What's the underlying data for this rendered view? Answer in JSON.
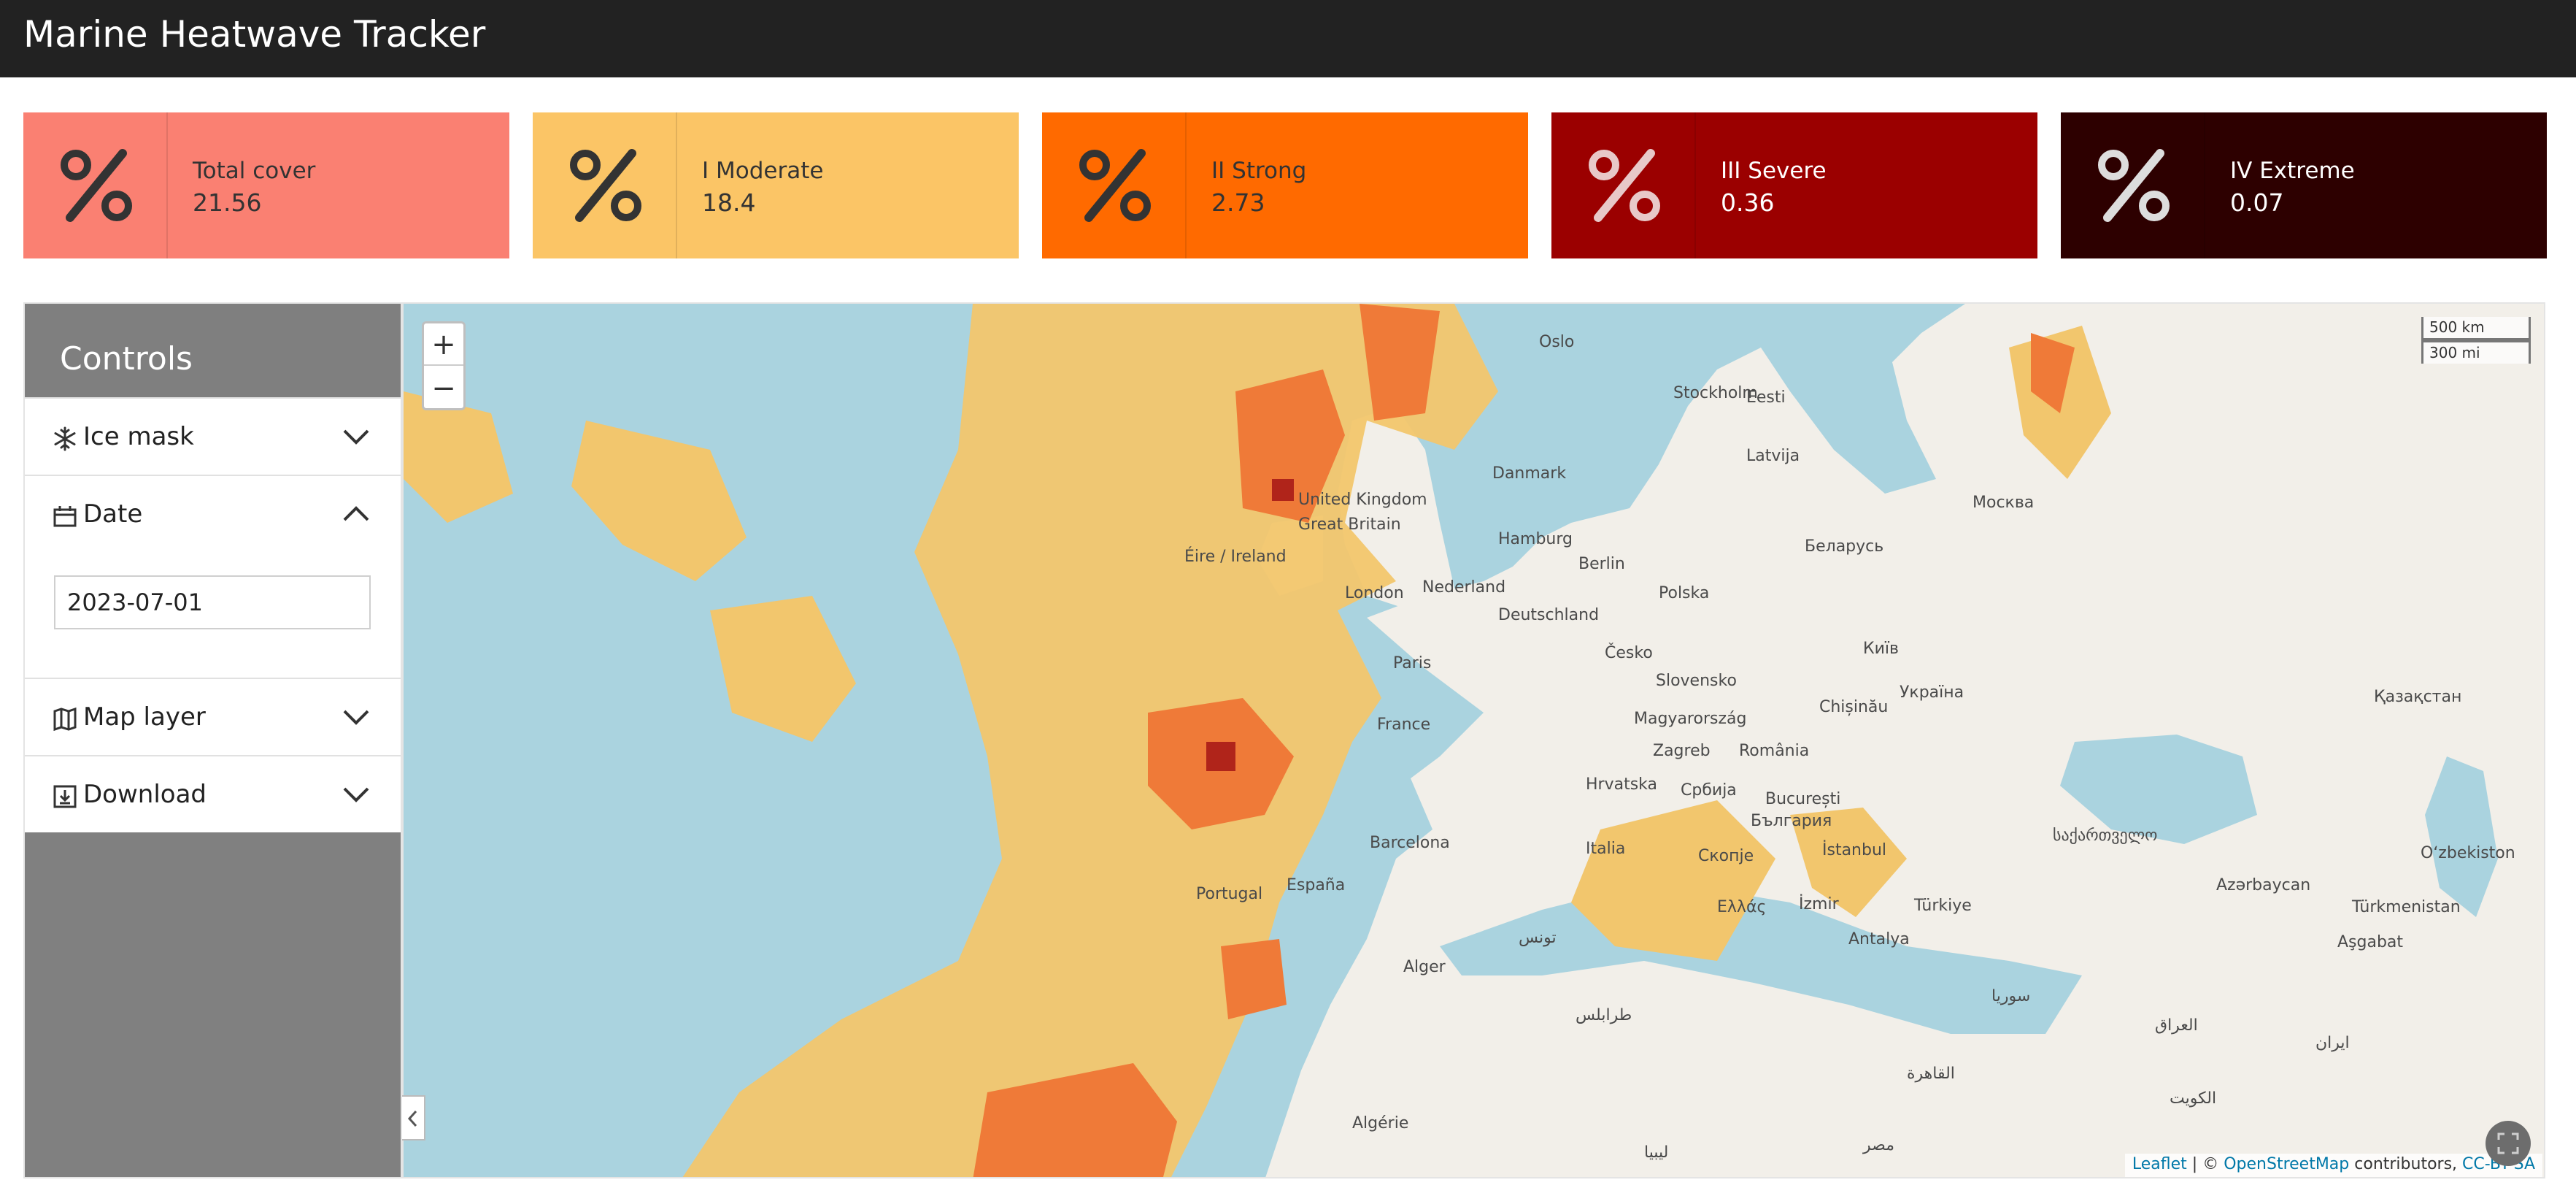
{
  "app": {
    "title": "Marine Heatwave Tracker"
  },
  "cards": [
    {
      "label": "Total cover",
      "value": "21.56",
      "icon": "percent-icon",
      "bg": "#fa8072",
      "fg": "#333333",
      "icon_color": "#333333"
    },
    {
      "label": "I Moderate",
      "value": "18.4",
      "icon": "percent-icon",
      "bg": "#fbc566",
      "fg": "#333333",
      "icon_color": "#333333"
    },
    {
      "label": "II Strong",
      "value": "2.73",
      "icon": "percent-icon",
      "bg": "#ff6a00",
      "fg": "#333333",
      "icon_color": "#333333"
    },
    {
      "label": "III Severe",
      "value": "0.36",
      "icon": "percent-icon",
      "bg": "#9b0000",
      "fg": "#ffffff",
      "icon_color": "#e8c8c8"
    },
    {
      "label": "IV Extreme",
      "value": "0.07",
      "icon": "percent-icon",
      "bg": "#2d0000",
      "fg": "#ffffff",
      "icon_color": "#dddddd"
    }
  ],
  "controls": {
    "title": "Controls",
    "sections": [
      {
        "label": "Ice mask",
        "icon": "snowflake-icon",
        "expanded": false
      },
      {
        "label": "Date",
        "icon": "calendar-icon",
        "expanded": true
      },
      {
        "label": "Map layer",
        "icon": "map-icon",
        "expanded": false
      },
      {
        "label": "Download",
        "icon": "download-icon",
        "expanded": false
      }
    ],
    "date_value": "2023-07-01"
  },
  "map": {
    "zoom_in": "+",
    "zoom_out": "−",
    "scale": [
      "500 km",
      "300 mi"
    ],
    "attribution": {
      "leaflet": "Leaflet",
      "sep": " | © ",
      "osm": "OpenStreetMap",
      "contrib": " contributors, ",
      "license": "CC-BY-SA"
    },
    "labels": [
      "Oslo",
      "Stockholm",
      "Eesti",
      "Latvija",
      "Danmark",
      "Москва",
      "United Kingdom",
      "Great Britain",
      "Éire / Ireland",
      "Hamburg",
      "Berlin",
      "Беларусь",
      "London",
      "Nederland",
      "Polska",
      "Deutschland",
      "Київ",
      "Paris",
      "Česko",
      "Slovensko",
      "Україна",
      "France",
      "Magyarország",
      "Chișinău",
      "Қазақстан",
      "Zagreb",
      "Hrvatska",
      "România",
      "Србија",
      "București",
      "България",
      "Barcelona",
      "Italia",
      "Portugal",
      "España",
      "Скопје",
      "İstanbul",
      "საქართველო",
      "Ελλάς",
      "İzmir",
      "Türkiye",
      "Azərbaycan",
      "Oʻzbekiston",
      "Türkmenistan",
      "Aşgabat",
      "Antalya",
      "Alger",
      "تونس",
      "طرابلس",
      "سوريا",
      "العراق",
      "ایران",
      "Algérie",
      "القاهرة",
      "مصر",
      "ليبيا",
      "الكويت"
    ]
  }
}
